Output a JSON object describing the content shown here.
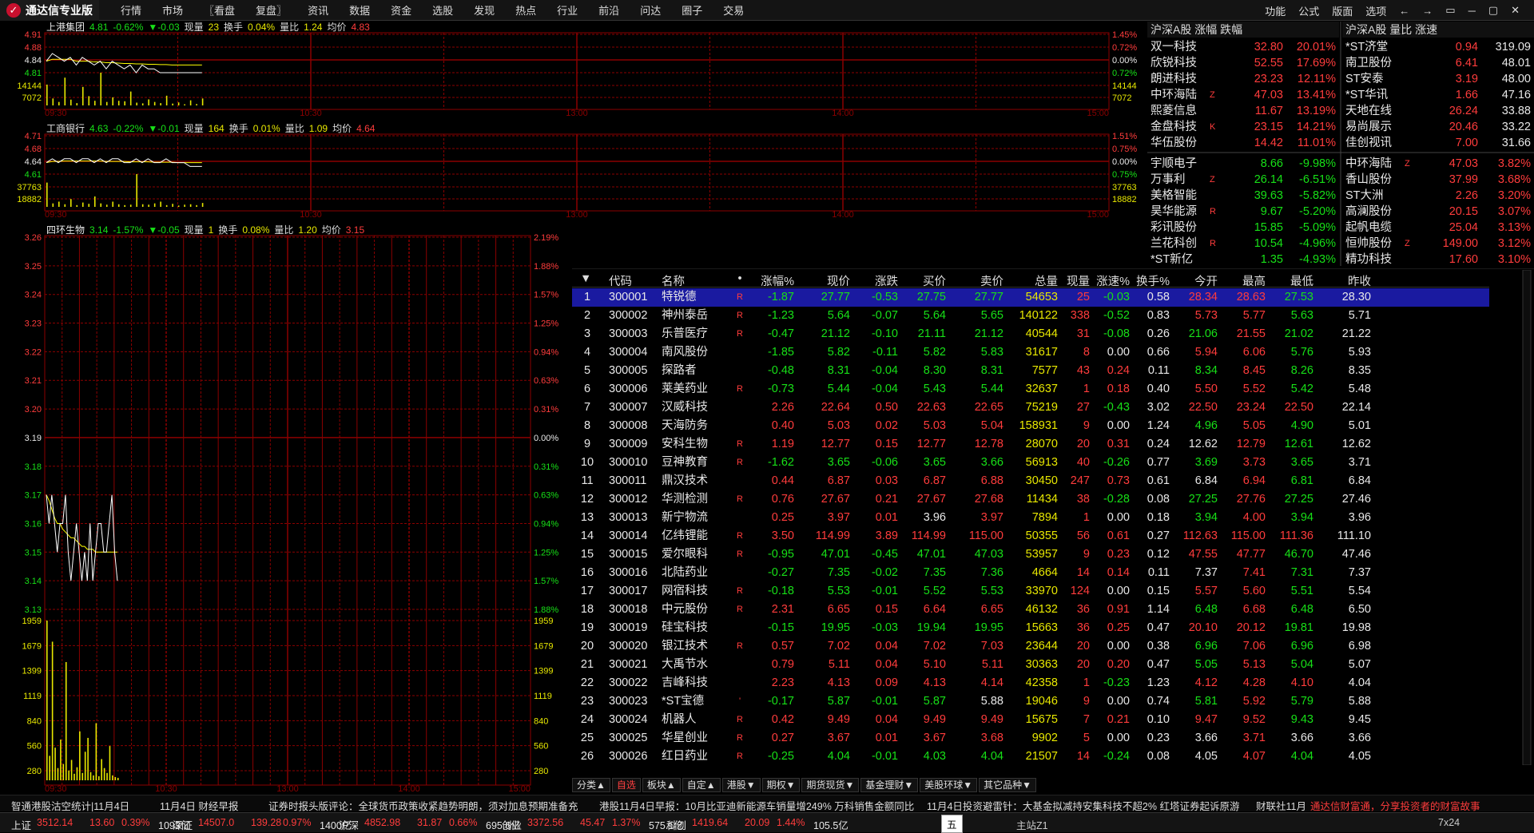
{
  "app": {
    "title": "通达信专业版"
  },
  "menu": [
    "行情",
    "市场",
    "〖看盘",
    "复盘〗",
    "资讯",
    "数据",
    "资金",
    "选股",
    "发现",
    "热点",
    "行业",
    "前沿",
    "问达",
    "圈子",
    "交易"
  ],
  "right_menu": [
    "功能",
    "公式",
    "版面",
    "选项"
  ],
  "window_buttons": [
    "←",
    "→",
    "▭",
    "─",
    "▢",
    "✕"
  ],
  "colors": {
    "up": "#ff3c3c",
    "down": "#17e017",
    "flat": "#e8e8e8",
    "vol": "#e8e800",
    "grid": "#8b0000",
    "price_line": "#ffffff",
    "avg_line": "#ffff00",
    "selected_row": "#1a1aa0"
  },
  "charts": [
    {
      "name": "上港集团",
      "price": "4.81",
      "change": "-0.62%",
      "delta": "▼-0.03",
      "cur_vol_label": "现量",
      "cur_vol": "23",
      "turnover_label": "换手",
      "turnover": "0.04%",
      "vol_ratio_label": "量比",
      "vol_ratio": "1.24",
      "avg_label": "均价",
      "avg": "4.83",
      "yticks": [
        "4.91",
        "4.88",
        "4.84",
        "4.81",
        "14144",
        "7072"
      ],
      "pct": [
        "1.45%",
        "0.72%",
        "0.00%",
        "0.72%",
        "14144",
        "7072"
      ],
      "times": [
        "09:30",
        "10:30",
        "13:00",
        "14:00",
        "15:00"
      ],
      "chart_data": {
        "type": "line",
        "prev_close": 4.84,
        "ylim": [
          4.77,
          4.91
        ],
        "price": [
          4.84,
          4.86,
          4.85,
          4.84,
          4.85,
          4.83,
          4.85,
          4.84,
          4.83,
          4.84,
          4.82,
          4.84,
          4.83,
          4.82,
          4.83,
          4.81,
          4.83,
          4.82,
          4.82,
          4.81,
          4.81,
          4.81,
          4.81,
          4.81,
          4.81,
          4.81,
          4.81
        ],
        "avg": [
          4.84,
          4.845,
          4.845,
          4.845,
          4.845,
          4.84,
          4.84,
          4.84,
          4.838,
          4.838,
          4.836,
          4.836,
          4.835,
          4.834,
          4.834,
          4.833,
          4.833,
          4.832,
          4.832,
          4.831,
          4.831,
          4.83,
          4.83,
          4.83,
          4.83,
          4.83,
          4.83
        ],
        "volume": [
          9000,
          3000,
          1500,
          12000,
          2500,
          1000,
          8000,
          4000,
          2000,
          14144,
          1500,
          3500,
          2000,
          1800,
          6000,
          1200,
          900,
          2600,
          1500,
          1000,
          4200,
          800,
          1300,
          500,
          2200,
          600,
          3000
        ],
        "vol_max": 14144
      }
    },
    {
      "name": "工商银行",
      "price": "4.63",
      "change": "-0.22%",
      "delta": "▼-0.01",
      "cur_vol_label": "现量",
      "cur_vol": "164",
      "turnover_label": "换手",
      "turnover": "0.01%",
      "vol_ratio_label": "量比",
      "vol_ratio": "1.09",
      "avg_label": "均价",
      "avg": "4.64",
      "yticks": [
        "4.71",
        "4.68",
        "4.64",
        "4.61",
        "37763",
        "18882"
      ],
      "pct": [
        "1.51%",
        "0.75%",
        "0.00%",
        "0.75%",
        "37763",
        "18882"
      ],
      "times": [
        "09:30",
        "10:30",
        "13:00",
        "14:00",
        "15:00"
      ],
      "chart_data": {
        "type": "line",
        "prev_close": 4.64,
        "ylim": [
          4.57,
          4.71
        ],
        "price": [
          4.64,
          4.65,
          4.64,
          4.65,
          4.65,
          4.64,
          4.65,
          4.65,
          4.64,
          4.65,
          4.64,
          4.65,
          4.65,
          4.64,
          4.64,
          4.65,
          4.64,
          4.65,
          4.64,
          4.64,
          4.65,
          4.64,
          4.64,
          4.64,
          4.63,
          4.63,
          4.63
        ],
        "avg": [
          4.64,
          4.643,
          4.643,
          4.644,
          4.644,
          4.644,
          4.644,
          4.644,
          4.644,
          4.644,
          4.643,
          4.643,
          4.643,
          4.643,
          4.642,
          4.642,
          4.642,
          4.642,
          4.641,
          4.641,
          4.641,
          4.641,
          4.64,
          4.64,
          4.64,
          4.64,
          4.64
        ],
        "volume": [
          28000,
          4000,
          6000,
          3000,
          9000,
          2000,
          5000,
          3500,
          12000,
          4000,
          2500,
          6000,
          3000,
          2000,
          2500,
          37763,
          3000,
          2500,
          4000,
          6000,
          2000,
          3500,
          1500,
          2500,
          3000,
          2000,
          4500
        ],
        "vol_max": 37763
      }
    },
    {
      "name": "四环生物",
      "price": "3.14",
      "change": "-1.57%",
      "delta": "▼-0.05",
      "cur_vol_label": "现量",
      "cur_vol": "1",
      "turnover_label": "换手",
      "turnover": "0.08%",
      "vol_ratio_label": "量比",
      "vol_ratio": "1.20",
      "avg_label": "均价",
      "avg": "3.15",
      "yticks": [
        "3.26",
        "3.25",
        "3.24",
        "3.23",
        "3.22",
        "3.21",
        "3.20",
        "3.19",
        "3.18",
        "3.17",
        "3.16",
        "3.15",
        "3.14",
        "3.13",
        "1959",
        "1679",
        "1399",
        "1119",
        "840",
        "560",
        "280"
      ],
      "pct": [
        "2.19%",
        "1.88%",
        "1.57%",
        "1.25%",
        "0.94%",
        "0.63%",
        "0.31%",
        "0.00%",
        "0.31%",
        "0.63%",
        "0.94%",
        "1.25%",
        "1.57%",
        "1.88%",
        "1959",
        "1679",
        "1399",
        "1119",
        "840",
        "560",
        "280"
      ],
      "times": [
        "09:30",
        "10:30",
        "13:00",
        "14:00",
        "15:00"
      ],
      "chart_data": {
        "type": "line",
        "prev_close": 3.19,
        "ylim": [
          3.12,
          3.26
        ],
        "price": [
          3.17,
          3.16,
          3.17,
          3.16,
          3.15,
          3.16,
          3.16,
          3.17,
          3.15,
          3.14,
          3.15,
          3.16,
          3.15,
          3.14,
          3.15,
          3.14,
          3.16,
          3.14,
          3.15,
          3.16,
          3.16,
          3.15,
          3.15,
          3.16,
          3.17,
          3.15,
          3.14
        ],
        "avg": [
          3.17,
          3.168,
          3.165,
          3.162,
          3.16,
          3.16,
          3.158,
          3.157,
          3.156,
          3.155,
          3.155,
          3.154,
          3.153,
          3.152,
          3.152,
          3.151,
          3.151,
          3.151,
          3.15,
          3.15,
          3.15,
          3.15,
          3.15,
          3.15,
          3.15,
          3.15,
          3.15
        ],
        "volume": [
          1959,
          300,
          1700,
          400,
          150,
          500,
          200,
          1450,
          120,
          250,
          80,
          160,
          600,
          90,
          350,
          520,
          100,
          60,
          700,
          50,
          260,
          150,
          90,
          420,
          60,
          40,
          30
        ],
        "vol_max": 1959
      }
    }
  ],
  "rank_up": {
    "title": "沪深A股 涨幅 跌幅",
    "up": [
      {
        "name": "双一科技",
        "flag": "",
        "price": "32.80",
        "pct": "20.01%"
      },
      {
        "name": "欣锐科技",
        "flag": "",
        "price": "52.55",
        "pct": "17.69%"
      },
      {
        "name": "朗进科技",
        "flag": "",
        "price": "23.23",
        "pct": "12.11%"
      },
      {
        "name": "中环海陆",
        "flag": "Z",
        "price": "47.03",
        "pct": "13.41%"
      },
      {
        "name": "熙菱信息",
        "flag": "",
        "price": "11.67",
        "pct": "13.19%"
      },
      {
        "name": "金盘科技",
        "flag": "K",
        "price": "23.15",
        "pct": "14.21%"
      },
      {
        "name": "华伍股份",
        "flag": "",
        "price": "14.42",
        "pct": "11.01%"
      }
    ],
    "down": [
      {
        "name": "宇顺电子",
        "flag": "",
        "price": "8.66",
        "pct": "-9.98%"
      },
      {
        "name": "万事利",
        "flag": "Z",
        "price": "26.14",
        "pct": "-6.51%"
      },
      {
        "name": "美格智能",
        "flag": "",
        "price": "39.63",
        "pct": "-5.82%"
      },
      {
        "name": "昊华能源",
        "flag": "R",
        "price": "9.67",
        "pct": "-5.20%"
      },
      {
        "name": "彩讯股份",
        "flag": "",
        "price": "15.85",
        "pct": "-5.09%"
      },
      {
        "name": "兰花科创",
        "flag": "R",
        "price": "10.54",
        "pct": "-4.96%"
      },
      {
        "name": "*ST新亿",
        "flag": "",
        "price": "1.35",
        "pct": "-4.93%"
      }
    ]
  },
  "rank_vol": {
    "title": "沪深A股 量比 涨速",
    "vol": [
      {
        "name": "*ST济堂",
        "flag": "",
        "price": "0.94",
        "val": "319.09"
      },
      {
        "name": "南卫股份",
        "flag": "",
        "price": "6.41",
        "val": "48.01"
      },
      {
        "name": "ST安泰",
        "flag": "",
        "price": "3.19",
        "val": "48.00"
      },
      {
        "name": "*ST华讯",
        "flag": "",
        "price": "1.66",
        "val": "47.16"
      },
      {
        "name": "天地在线",
        "flag": "",
        "price": "26.24",
        "val": "33.88"
      },
      {
        "name": "易尚展示",
        "flag": "",
        "price": "20.46",
        "val": "33.22"
      },
      {
        "name": "佳创视讯",
        "flag": "",
        "price": "7.00",
        "val": "31.66"
      }
    ],
    "speed": [
      {
        "name": "中环海陆",
        "flag": "Z",
        "price": "47.03",
        "val": "3.82%"
      },
      {
        "name": "香山股份",
        "flag": "",
        "price": "37.99",
        "val": "3.68%"
      },
      {
        "name": "ST大洲",
        "flag": "",
        "price": "2.26",
        "val": "3.20%"
      },
      {
        "name": "高澜股份",
        "flag": "",
        "price": "20.15",
        "val": "3.07%"
      },
      {
        "name": "起帆电缆",
        "flag": "",
        "price": "25.04",
        "val": "3.13%"
      },
      {
        "name": "恒帅股份",
        "flag": "Z",
        "price": "149.00",
        "val": "3.12%"
      },
      {
        "name": "精功科技",
        "flag": "",
        "price": "17.60",
        "val": "3.10%"
      }
    ]
  },
  "grid": {
    "headers": [
      "代码",
      "名称",
      "•",
      "涨幅%",
      "现价",
      "涨跌",
      "买价",
      "卖价",
      "总量",
      "现量",
      "涨速%",
      "换手%",
      "今开",
      "最高",
      "最低",
      "昨收"
    ],
    "rows": [
      [
        "1",
        "300001",
        "特锐德",
        "R",
        "-1.87",
        "27.77",
        "-0.53",
        "27.75",
        "27.77",
        "54653",
        "25",
        "-0.03",
        "0.58",
        "28.34",
        "28.63",
        "27.53",
        "28.30"
      ],
      [
        "2",
        "300002",
        "神州泰岳",
        "R",
        "-1.23",
        "5.64",
        "-0.07",
        "5.64",
        "5.65",
        "140122",
        "338",
        "-0.52",
        "0.83",
        "5.73",
        "5.77",
        "5.63",
        "5.71"
      ],
      [
        "3",
        "300003",
        "乐普医疗",
        "R",
        "-0.47",
        "21.12",
        "-0.10",
        "21.11",
        "21.12",
        "40544",
        "31",
        "-0.08",
        "0.26",
        "21.06",
        "21.55",
        "21.02",
        "21.22"
      ],
      [
        "4",
        "300004",
        "南风股份",
        "",
        "-1.85",
        "5.82",
        "-0.11",
        "5.82",
        "5.83",
        "31617",
        "8",
        "0.00",
        "0.66",
        "5.94",
        "6.06",
        "5.76",
        "5.93"
      ],
      [
        "5",
        "300005",
        "探路者",
        "",
        "-0.48",
        "8.31",
        "-0.04",
        "8.30",
        "8.31",
        "7577",
        "43",
        "0.24",
        "0.11",
        "8.34",
        "8.45",
        "8.26",
        "8.35"
      ],
      [
        "6",
        "300006",
        "莱美药业",
        "R",
        "-0.73",
        "5.44",
        "-0.04",
        "5.43",
        "5.44",
        "32637",
        "1",
        "0.18",
        "0.40",
        "5.50",
        "5.52",
        "5.42",
        "5.48"
      ],
      [
        "7",
        "300007",
        "汉威科技",
        "",
        "2.26",
        "22.64",
        "0.50",
        "22.63",
        "22.65",
        "75219",
        "27",
        "-0.43",
        "3.02",
        "22.50",
        "23.24",
        "22.50",
        "22.14"
      ],
      [
        "8",
        "300008",
        "天海防务",
        "",
        "0.40",
        "5.03",
        "0.02",
        "5.03",
        "5.04",
        "158931",
        "9",
        "0.00",
        "1.24",
        "4.96",
        "5.05",
        "4.90",
        "5.01"
      ],
      [
        "9",
        "300009",
        "安科生物",
        "R",
        "1.19",
        "12.77",
        "0.15",
        "12.77",
        "12.78",
        "28070",
        "20",
        "0.31",
        "0.24",
        "12.62",
        "12.79",
        "12.61",
        "12.62"
      ],
      [
        "10",
        "300010",
        "豆神教育",
        "R",
        "-1.62",
        "3.65",
        "-0.06",
        "3.65",
        "3.66",
        "56913",
        "40",
        "-0.26",
        "0.77",
        "3.69",
        "3.73",
        "3.65",
        "3.71"
      ],
      [
        "11",
        "300011",
        "鼎汉技术",
        "",
        "0.44",
        "6.87",
        "0.03",
        "6.87",
        "6.88",
        "30450",
        "247",
        "0.73",
        "0.61",
        "6.84",
        "6.94",
        "6.81",
        "6.84"
      ],
      [
        "12",
        "300012",
        "华测检测",
        "R",
        "0.76",
        "27.67",
        "0.21",
        "27.67",
        "27.68",
        "11434",
        "38",
        "-0.28",
        "0.08",
        "27.25",
        "27.76",
        "27.25",
        "27.46"
      ],
      [
        "13",
        "300013",
        "新宁物流",
        "",
        "0.25",
        "3.97",
        "0.01",
        "3.96",
        "3.97",
        "7894",
        "1",
        "0.00",
        "0.18",
        "3.94",
        "4.00",
        "3.94",
        "3.96"
      ],
      [
        "14",
        "300014",
        "亿纬锂能",
        "R",
        "3.50",
        "114.99",
        "3.89",
        "114.99",
        "115.00",
        "50355",
        "56",
        "0.61",
        "0.27",
        "112.63",
        "115.00",
        "111.36",
        "111.10"
      ],
      [
        "15",
        "300015",
        "爱尔眼科",
        "R",
        "-0.95",
        "47.01",
        "-0.45",
        "47.01",
        "47.03",
        "53957",
        "9",
        "0.23",
        "0.12",
        "47.55",
        "47.77",
        "46.70",
        "47.46"
      ],
      [
        "16",
        "300016",
        "北陆药业",
        "",
        "-0.27",
        "7.35",
        "-0.02",
        "7.35",
        "7.36",
        "4664",
        "14",
        "0.14",
        "0.11",
        "7.37",
        "7.41",
        "7.31",
        "7.37"
      ],
      [
        "17",
        "300017",
        "网宿科技",
        "R",
        "-0.18",
        "5.53",
        "-0.01",
        "5.52",
        "5.53",
        "33970",
        "124",
        "0.00",
        "0.15",
        "5.57",
        "5.60",
        "5.51",
        "5.54"
      ],
      [
        "18",
        "300018",
        "中元股份",
        "R",
        "2.31",
        "6.65",
        "0.15",
        "6.64",
        "6.65",
        "46132",
        "36",
        "0.91",
        "1.14",
        "6.48",
        "6.68",
        "6.48",
        "6.50"
      ],
      [
        "19",
        "300019",
        "硅宝科技",
        "",
        "-0.15",
        "19.95",
        "-0.03",
        "19.94",
        "19.95",
        "15663",
        "36",
        "0.25",
        "0.47",
        "20.10",
        "20.12",
        "19.81",
        "19.98"
      ],
      [
        "20",
        "300020",
        "银江技术",
        "R",
        "0.57",
        "7.02",
        "0.04",
        "7.02",
        "7.03",
        "23644",
        "20",
        "0.00",
        "0.38",
        "6.96",
        "7.06",
        "6.96",
        "6.98"
      ],
      [
        "21",
        "300021",
        "大禹节水",
        "",
        "0.79",
        "5.11",
        "0.04",
        "5.10",
        "5.11",
        "30363",
        "20",
        "0.20",
        "0.47",
        "5.05",
        "5.13",
        "5.04",
        "5.07"
      ],
      [
        "22",
        "300022",
        "吉峰科技",
        "",
        "2.23",
        "4.13",
        "0.09",
        "4.13",
        "4.14",
        "42358",
        "1",
        "-0.23",
        "1.23",
        "4.12",
        "4.28",
        "4.10",
        "4.04"
      ],
      [
        "23",
        "300023",
        "*ST宝德",
        "'",
        "-0.17",
        "5.87",
        "-0.01",
        "5.87",
        "5.88",
        "19046",
        "9",
        "0.00",
        "0.74",
        "5.81",
        "5.92",
        "5.79",
        "5.88"
      ],
      [
        "24",
        "300024",
        "机器人",
        "R",
        "0.42",
        "9.49",
        "0.04",
        "9.49",
        "9.49",
        "15675",
        "7",
        "0.21",
        "0.10",
        "9.47",
        "9.52",
        "9.43",
        "9.45"
      ],
      [
        "25",
        "300025",
        "华星创业",
        "R",
        "0.27",
        "3.67",
        "0.01",
        "3.67",
        "3.68",
        "9902",
        "5",
        "0.00",
        "0.23",
        "3.66",
        "3.71",
        "3.66",
        "3.66"
      ],
      [
        "26",
        "300026",
        "红日药业",
        "R",
        "-0.25",
        "4.04",
        "-0.01",
        "4.03",
        "4.04",
        "21507",
        "14",
        "-0.24",
        "0.08",
        "4.05",
        "4.07",
        "4.04",
        "4.05"
      ]
    ]
  },
  "tabs": [
    "分类▲",
    "自选",
    "板块▲",
    "自定▲",
    "港股▼",
    "期权▼",
    "期货现货▼",
    "基金理财▼",
    "美股环球▼",
    "其它品种▼"
  ],
  "ticker": [
    "智通港股沽空统计|11月4日",
    "11月4日 财经早报",
    "证券时报头版评论：全球货币政策收紧趋势明朗，须对加息预期准备充",
    "港股11月4日早报：10月比亚迪新能源车销量增249% 万科销售金额同比",
    "11月4日投资避雷针：大基金拟减持安集科技不超2% 红塔证券起诉原游",
    "财联社11月",
    "通达信财富通，分享投资者的财富故事"
  ],
  "status": [
    {
      "label": "上证",
      "v": "3512.14",
      "c": "13.60",
      "p": "0.39%",
      "amt": "1093亿"
    },
    {
      "label": "深证",
      "v": "14507.0",
      "c": "139.28",
      "p": "0.97%",
      "amt": "1400亿"
    },
    {
      "label": "沪深",
      "v": "4852.98",
      "c": "31.87",
      "p": "0.66%",
      "amt": "695.6亿"
    },
    {
      "label": "创业",
      "v": "3372.56",
      "c": "45.47",
      "p": "1.37%",
      "amt": "575.1亿"
    },
    {
      "label": "科创",
      "v": "1419.64",
      "c": "20.09",
      "p": "1.44%",
      "amt": "105.5亿"
    }
  ],
  "status_extra": {
    "site": "主站Z1",
    "clock": "7x24"
  },
  "ime": {
    "mode": "五"
  }
}
